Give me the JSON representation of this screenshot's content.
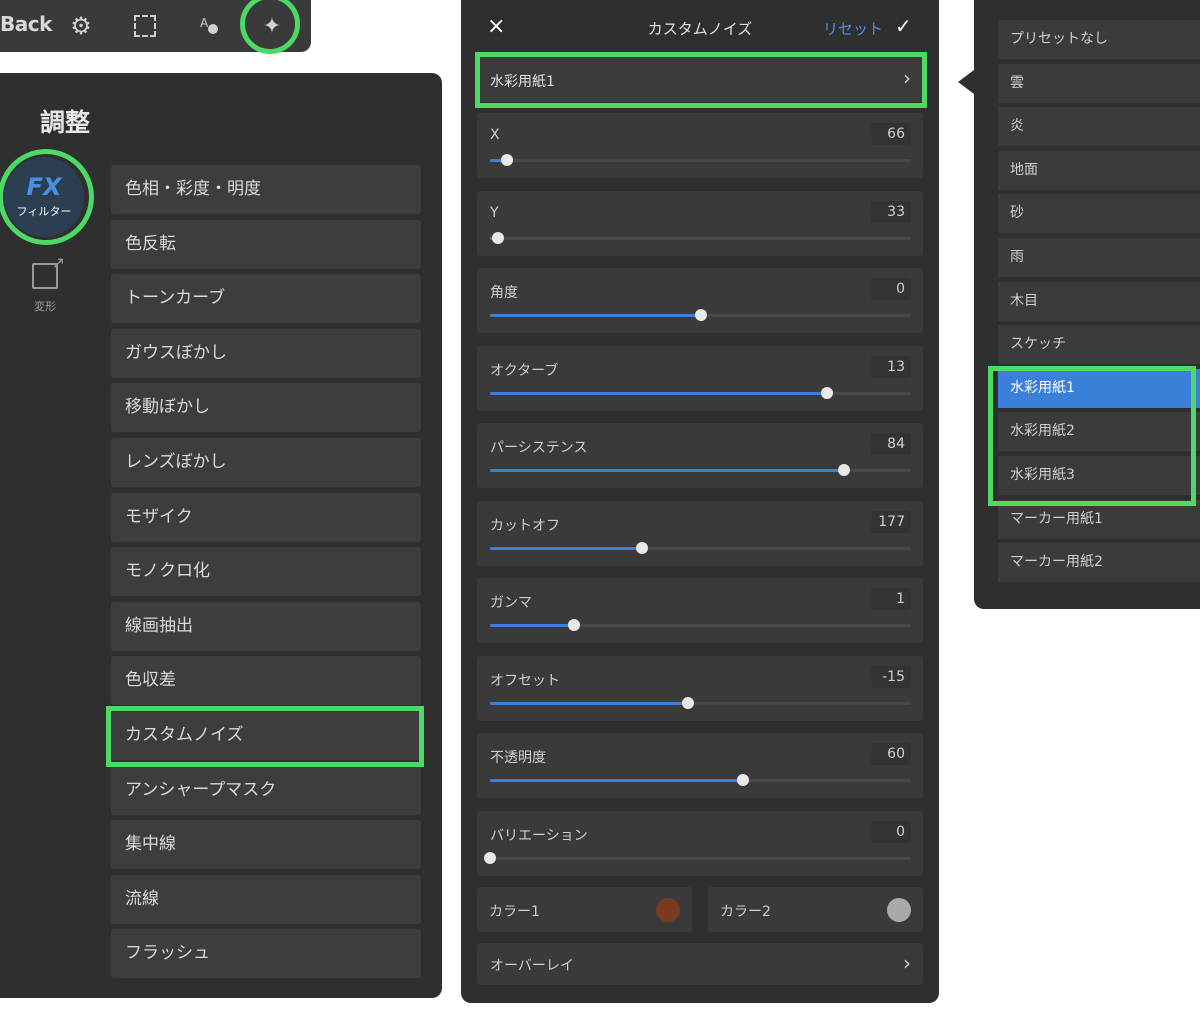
{
  "toolbar": {
    "back_label": "Back",
    "icons": [
      "gear-icon",
      "selection-icon",
      "text-shape-icon",
      "sparkle-icon"
    ]
  },
  "left_panel": {
    "title": "調整",
    "tabs": [
      {
        "icon": "FX",
        "label": "フィルター",
        "selected": true
      },
      {
        "icon": "transform-icon",
        "label": "変形",
        "selected": false
      }
    ],
    "filters": [
      "色相・彩度・明度",
      "色反転",
      "トーンカーブ",
      "ガウスぼかし",
      "移動ぼかし",
      "レンズぼかし",
      "モザイク",
      "モノクロ化",
      "線画抽出",
      "色収差",
      "カスタムノイズ",
      "アンシャープマスク",
      "集中線",
      "流線",
      "フラッシュ"
    ],
    "highlighted_filter": "カスタムノイズ"
  },
  "noise_panel": {
    "title": "カスタムノイズ",
    "close_symbol": "×",
    "reset_label": "リセット",
    "confirm_symbol": "✓",
    "preset_value": "水彩用紙1",
    "preset_chevron": "›",
    "sliders": [
      {
        "label": "X",
        "value": "66",
        "level": 0.04
      },
      {
        "label": "Y",
        "value": "33",
        "level": 0.02
      },
      {
        "label": "角度",
        "value": "0",
        "level": 0.5
      },
      {
        "label": "オクターブ",
        "value": "13",
        "level": 0.8
      },
      {
        "label": "パーシステンス",
        "value": "84",
        "level": 0.84
      },
      {
        "label": "カットオフ",
        "value": "177",
        "level": 0.36
      },
      {
        "label": "ガンマ",
        "value": "1",
        "level": 0.2
      },
      {
        "label": "オフセット",
        "value": "-15",
        "level": 0.47
      },
      {
        "label": "不透明度",
        "value": "60",
        "level": 0.6
      },
      {
        "label": "バリエーション",
        "value": "0",
        "level": 0.0
      }
    ],
    "color1_label": "カラー1",
    "color1_swatch": "#7a3a1e",
    "color2_label": "カラー2",
    "color2_swatch": "#a9a9a9",
    "overlay_label": "オーバーレイ",
    "overlay_chevron": "›"
  },
  "preset_panel": {
    "items": [
      "プリセットなし",
      "雲",
      "炎",
      "地面",
      "砂",
      "雨",
      "木目",
      "スケッチ",
      "水彩用紙1",
      "水彩用紙2",
      "水彩用紙3",
      "マーカー用紙1",
      "マーカー用紙2"
    ],
    "selected": "水彩用紙1"
  },
  "colors": {
    "accent": "#3a7fd9",
    "highlight": "#4cd964",
    "panel": "#2f2f2f",
    "row": "#3b3b3b"
  }
}
